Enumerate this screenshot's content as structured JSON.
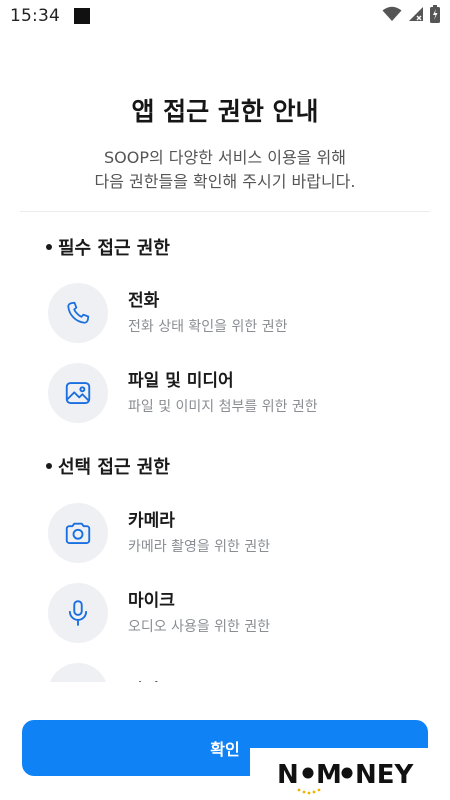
{
  "status_bar": {
    "time": "15:34",
    "icons": [
      "notification-square-icon",
      "wifi-icon",
      "signal-icon",
      "battery-icon"
    ]
  },
  "header": {
    "title": "앱 접근 권한 안내",
    "subtitle_line1": "SOOP의 다양한 서비스 이용을 위해",
    "subtitle_line2": "다음 권한들을 확인해 주시기 바랍니다."
  },
  "sections": {
    "required": {
      "label": "필수 접근 권한",
      "items": [
        {
          "name": "전화",
          "desc": "전화 상태 확인을 위한 권한",
          "icon": "phone-icon"
        },
        {
          "name": "파일 및 미디어",
          "desc": "파일 및 이미지 첨부를 위한 권한",
          "icon": "image-icon"
        }
      ]
    },
    "optional": {
      "label": "선택 접근 권한",
      "items": [
        {
          "name": "카메라",
          "desc": "카메라 촬영을 위한 권한",
          "icon": "camera-icon"
        },
        {
          "name": "마이크",
          "desc": "오디오 사용을 위한 권한",
          "icon": "microphone-icon"
        },
        {
          "name": "알림",
          "desc": "",
          "icon": "bell-icon"
        }
      ]
    }
  },
  "footer": {
    "confirm_label": "확인"
  },
  "watermark": {
    "text": "NOMONEY"
  },
  "colors": {
    "accent": "#0f82f5",
    "icon_stroke": "#1a6fe0",
    "icon_bg": "#eef0f3"
  }
}
